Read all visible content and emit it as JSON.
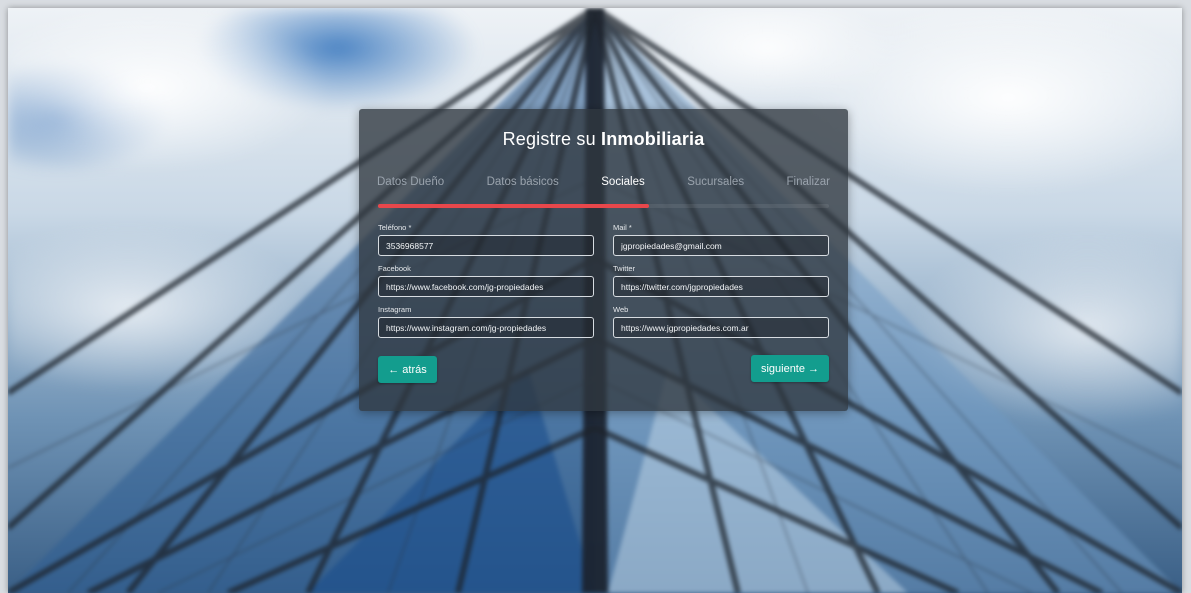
{
  "form": {
    "title_prefix": "Registre su",
    "title_bold": "Inmobiliaria",
    "steps": [
      {
        "label": "Datos Dueño"
      },
      {
        "label": "Datos básicos"
      },
      {
        "label": "Sociales"
      },
      {
        "label": "Sucursales"
      },
      {
        "label": "Finalizar"
      }
    ],
    "active_step": "Sociales",
    "progress": 0.6,
    "progress_color": "#e8474b",
    "fields": {
      "telefono": {
        "label": "Teléfono *",
        "value": "3536968577"
      },
      "mail": {
        "label": "Mail *",
        "value": "jgpropiedades@gmail.com"
      },
      "facebook": {
        "label": "Facebook",
        "value": "https://www.facebook.com/jg-propiedades"
      },
      "twitter": {
        "label": "Twitter",
        "value": "https://twitter.com/jgpropiedades"
      },
      "instagram": {
        "label": "Instagram",
        "value": "https://www.instagram.com/jg-propiedades"
      },
      "web": {
        "label": "Web",
        "value": "https://www.jgpropiedades.com.ar"
      }
    },
    "back_button": "← atrás",
    "next_button": "siguiente →",
    "button_color": "#139d8e"
  }
}
